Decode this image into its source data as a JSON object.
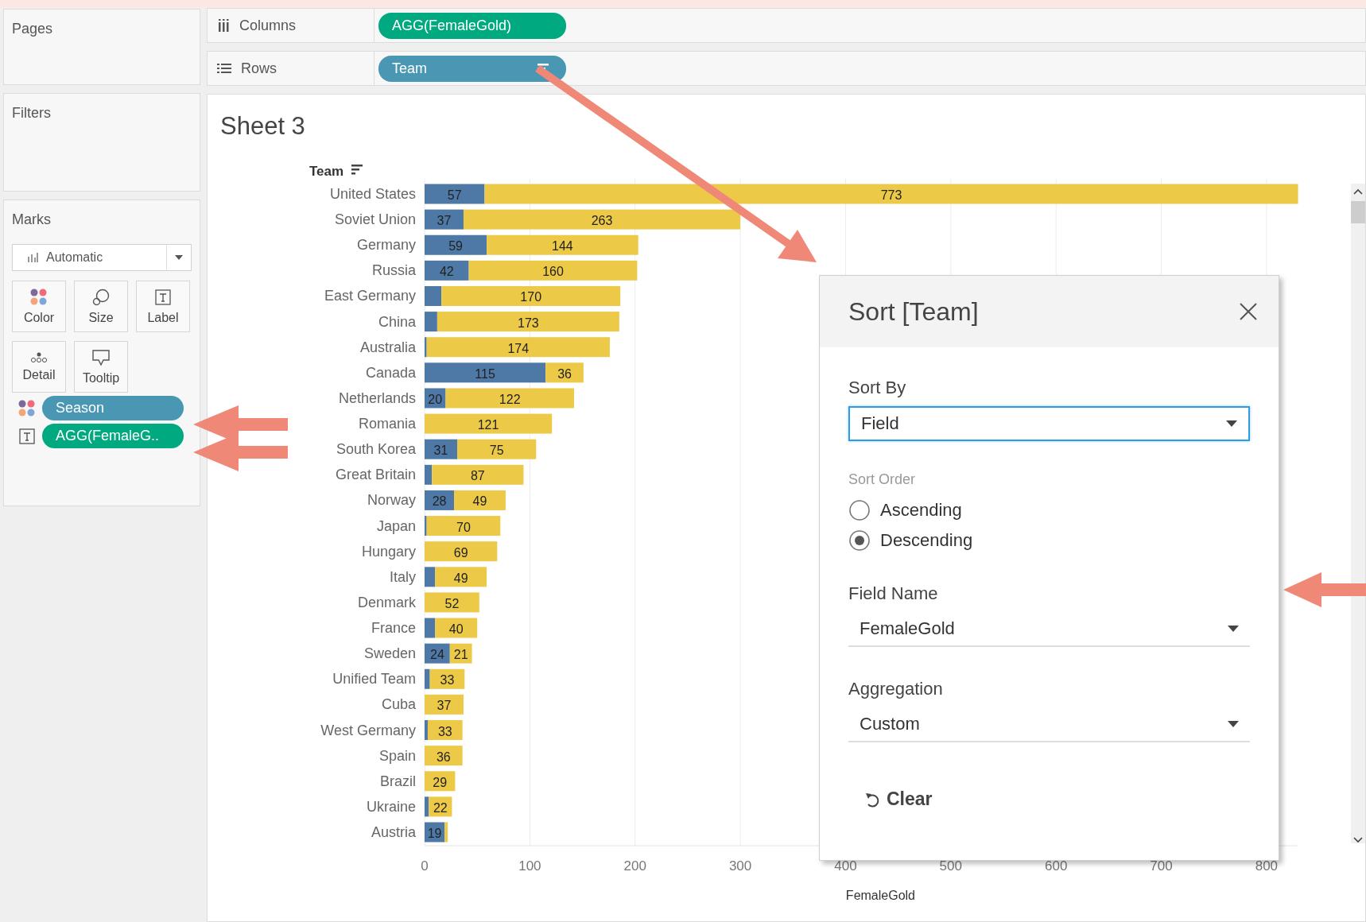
{
  "left_panel": {
    "pages": {
      "title": "Pages"
    },
    "filters": {
      "title": "Filters"
    },
    "marks": {
      "title": "Marks",
      "mark_type": "Automatic",
      "cards": [
        {
          "label": "Color",
          "kind": "color"
        },
        {
          "label": "Size",
          "kind": "size"
        },
        {
          "label": "Label",
          "kind": "label"
        },
        {
          "label": "Detail",
          "kind": "detail"
        },
        {
          "label": "Tooltip",
          "kind": "tooltip"
        }
      ],
      "fields": [
        {
          "text": "Season",
          "kind": "color"
        },
        {
          "text": "AGG(FemaleG..",
          "kind": "label"
        }
      ]
    }
  },
  "shelves": [
    {
      "label": "Columns",
      "kind": "columns",
      "pills": [
        {
          "text": "AGG(FemaleGold)",
          "kind": "measure",
          "sorted": false
        }
      ]
    },
    {
      "label": "Rows",
      "kind": "rows",
      "pills": [
        {
          "text": "Team",
          "kind": "dimension",
          "sorted": true
        }
      ]
    }
  ],
  "sheet": {
    "title": "Sheet 3",
    "row_header": "Team",
    "chart_data": {
      "type": "bar",
      "orientation": "horizontal",
      "stacked": true,
      "grid": true,
      "xlabel": "FemaleGold",
      "categories": [
        "United States",
        "Soviet Union",
        "Germany",
        "Russia",
        "East Germany",
        "China",
        "Australia",
        "Canada",
        "Netherlands",
        "Romania",
        "South Korea",
        "Great Britain",
        "Norway",
        "Japan",
        "Hungary",
        "Italy",
        "Denmark",
        "France",
        "Sweden",
        "Unified Team",
        "Cuba",
        "West Germany",
        "Spain",
        "Brazil",
        "Ukraine",
        "Austria"
      ],
      "xticks": [
        0,
        100,
        200,
        300,
        400,
        500,
        600,
        700,
        800
      ],
      "xlim": [
        0,
        830
      ],
      "series": [
        {
          "color": "#4e79a7",
          "values": [
            57,
            37,
            59,
            42,
            16,
            12,
            2,
            115,
            20,
            0,
            31,
            7,
            28,
            2,
            0,
            10,
            0,
            10,
            24,
            5,
            0,
            3,
            0,
            0,
            4,
            19
          ]
        },
        {
          "color": "#edc948",
          "values": [
            773,
            263,
            144,
            160,
            170,
            173,
            174,
            36,
            122,
            121,
            75,
            87,
            49,
            70,
            69,
            49,
            52,
            40,
            21,
            33,
            37,
            33,
            36,
            29,
            22,
            3
          ]
        }
      ],
      "value_labels": [
        [
          "57",
          "37",
          "59",
          "42",
          null,
          null,
          null,
          "115",
          "20",
          null,
          "31",
          null,
          "28",
          null,
          null,
          null,
          null,
          null,
          "24",
          null,
          null,
          null,
          null,
          null,
          null,
          "19"
        ],
        [
          "773",
          "263",
          "144",
          "160",
          "170",
          "173",
          "174",
          "36",
          "122",
          "121",
          "75",
          "87",
          "49",
          "70",
          "69",
          "49",
          "52",
          "40",
          "21",
          "33",
          "37",
          "33",
          "36",
          "29",
          "22",
          null
        ]
      ]
    }
  },
  "sort_dialog": {
    "title": "Sort [Team]",
    "sort_by": {
      "label": "Sort By",
      "value": "Field",
      "focused": true
    },
    "sort_order": {
      "label": "Sort Order",
      "options": [
        {
          "label": "Ascending",
          "selected": false
        },
        {
          "label": "Descending",
          "selected": true
        }
      ]
    },
    "field_name": {
      "label": "Field Name",
      "value": "FemaleGold",
      "focused": false
    },
    "aggregation": {
      "label": "Aggregation",
      "value": "Custom",
      "focused": false
    },
    "clear": "Clear"
  }
}
